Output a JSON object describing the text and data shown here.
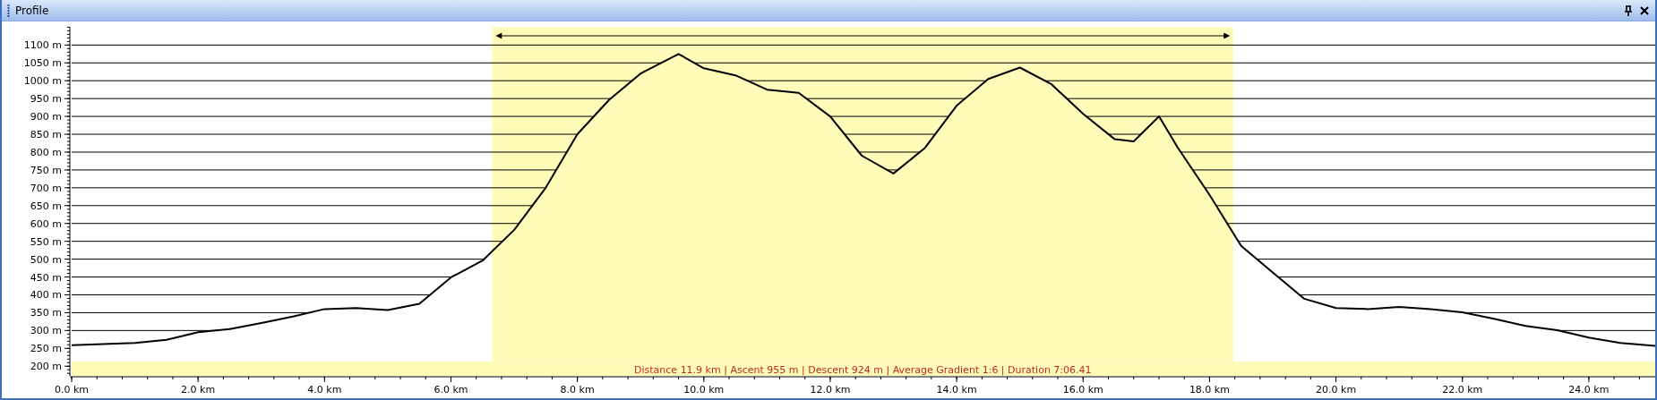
{
  "window": {
    "title": "Profile"
  },
  "profile": {
    "summary": "Distance 11.9 km | Ascent 955 m | Descent 924 m | Average Gradient 1:6 | Duration 7:06.41",
    "chart_data": {
      "type": "line",
      "xlim": [
        0,
        25.05
      ],
      "ylim": [
        173,
        1151
      ],
      "x": [
        0,
        0.5,
        1,
        1.5,
        2,
        2.5,
        3,
        3.5,
        4,
        4.5,
        5,
        5.5,
        6,
        6.5,
        7,
        7.5,
        8,
        8.5,
        9,
        9.6,
        10,
        10.5,
        11,
        11.5,
        12,
        12.5,
        13,
        13.5,
        14,
        14.5,
        15,
        15.5,
        16,
        16.5,
        16.8,
        17.2,
        17.5,
        18,
        18.5,
        19,
        19.5,
        20,
        20.5,
        21,
        21.5,
        22,
        22.5,
        23,
        23.5,
        24,
        24.5,
        25.05
      ],
      "series": [
        {
          "color": "#000000",
          "values": [
            259,
            262,
            265,
            274,
            295,
            304,
            321,
            339,
            360,
            363,
            357,
            375,
            449,
            496,
            582,
            700,
            850,
            946,
            1020,
            1075,
            1035,
            1015,
            975,
            966,
            900,
            790,
            740,
            812,
            930,
            1005,
            1037,
            990,
            907,
            836,
            830,
            900,
            812,
            680,
            537,
            463,
            389,
            363,
            360,
            366,
            360,
            351,
            333,
            313,
            301,
            280,
            265,
            257
          ]
        }
      ],
      "xticks": [
        {
          "value": 0,
          "label": "0.0 km"
        },
        {
          "value": 2,
          "label": "2.0 km"
        },
        {
          "value": 4,
          "label": "4.0 km"
        },
        {
          "value": 6,
          "label": "6.0 km"
        },
        {
          "value": 8,
          "label": "8.0 km"
        },
        {
          "value": 10,
          "label": "10.0 km"
        },
        {
          "value": 12,
          "label": "12.0 km"
        },
        {
          "value": 14,
          "label": "14.0 km"
        },
        {
          "value": 16,
          "label": "16.0 km"
        },
        {
          "value": 18,
          "label": "18.0 km"
        },
        {
          "value": 20,
          "label": "20.0 km"
        },
        {
          "value": 22,
          "label": "22.0 km"
        },
        {
          "value": 24,
          "label": "24.0 km"
        }
      ],
      "yticks": [
        {
          "value": 200,
          "label": "200 m"
        },
        {
          "value": 250,
          "label": "250 m"
        },
        {
          "value": 300,
          "label": "300 m"
        },
        {
          "value": 350,
          "label": "350 m"
        },
        {
          "value": 400,
          "label": "400 m"
        },
        {
          "value": 450,
          "label": "450 m"
        },
        {
          "value": 500,
          "label": "500 m"
        },
        {
          "value": 550,
          "label": "550 m"
        },
        {
          "value": 600,
          "label": "600 m"
        },
        {
          "value": 650,
          "label": "650 m"
        },
        {
          "value": 700,
          "label": "700 m"
        },
        {
          "value": 750,
          "label": "750 m"
        },
        {
          "value": 800,
          "label": "800 m"
        },
        {
          "value": 850,
          "label": "850 m"
        },
        {
          "value": 900,
          "label": "900 m"
        },
        {
          "value": 950,
          "label": "950 m"
        },
        {
          "value": 1000,
          "label": "1000 m"
        },
        {
          "value": 1050,
          "label": "1050 m"
        },
        {
          "value": 1100,
          "label": "1100 m"
        }
      ],
      "grid": true,
      "bands": [
        {
          "axis": "x",
          "from": 6.65,
          "to": 18.38,
          "color": "#fffbb8"
        }
      ]
    }
  }
}
